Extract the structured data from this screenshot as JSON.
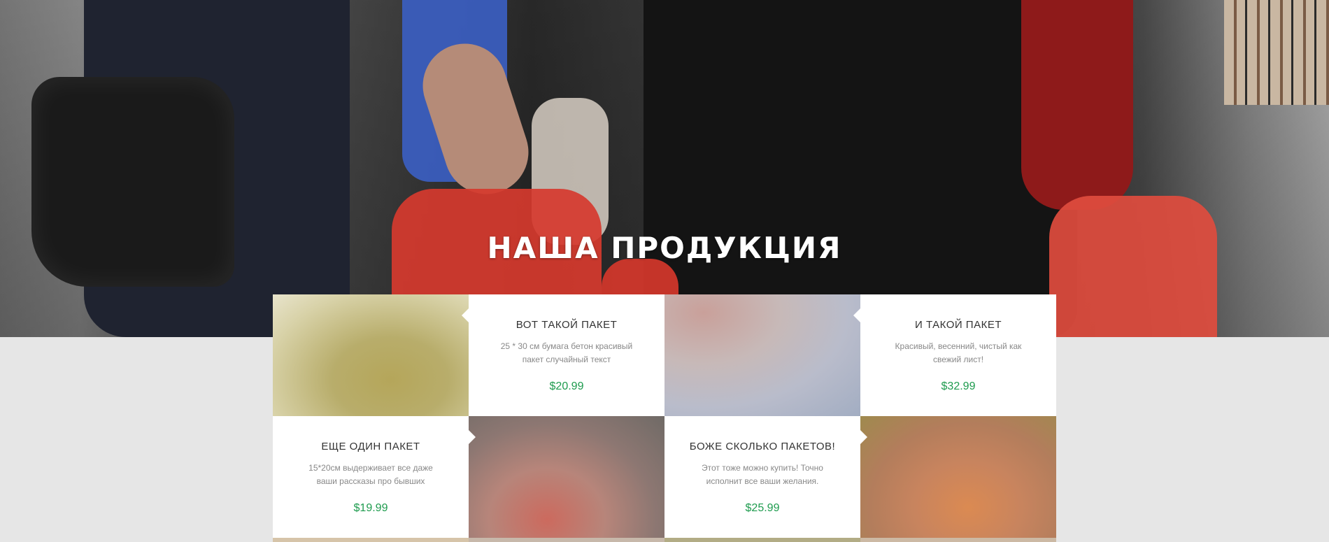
{
  "hero": {
    "title": "НАША ПРОДУКЦИЯ"
  },
  "products": [
    {
      "title": "ВОТ ТАКОЙ ПАКЕТ",
      "description": "25 * 30 см бумага бетон красивый пакет случайный текст",
      "price": "$20.99"
    },
    {
      "title": "И ТАКОЙ ПАКЕТ",
      "description": "Красивый, весенний, чистый как свежий лист!",
      "price": "$32.99"
    },
    {
      "title": "ЕЩЕ ОДИН ПАКЕТ",
      "description": "15*20см выдерживает все даже ваши рассказы про бывших",
      "price": "$19.99"
    },
    {
      "title": "БОЖЕ СКОЛЬКО ПАКЕТОВ!",
      "description": "Этот тоже можно купить! Точно исполнит все ваши желания.",
      "price": "$25.99"
    }
  ],
  "colors": {
    "price": "#1e9b4e",
    "page_background": "#e6e6e6",
    "card_background": "#ffffff"
  }
}
